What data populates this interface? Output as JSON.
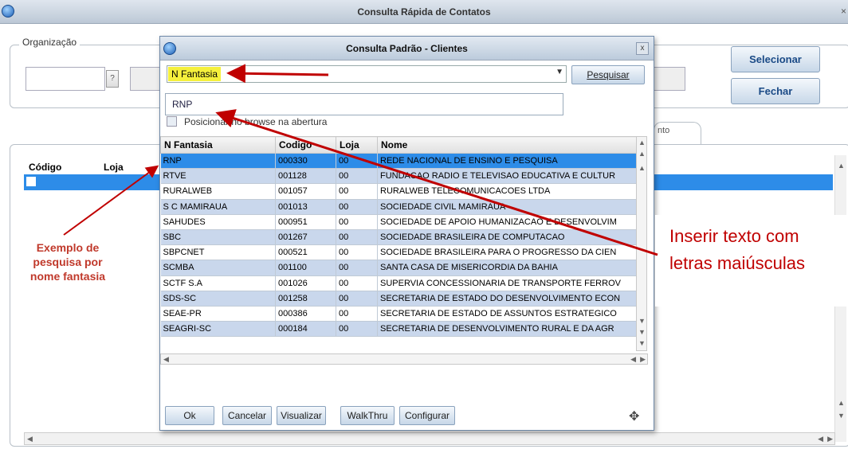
{
  "main_window": {
    "title": "Consulta Rápida de Contatos",
    "close_label": "×",
    "organization_label": "Organização",
    "help_button_label": "?",
    "select_button": "Selecionar",
    "close_button": "Fechar",
    "tab_fragment": "nto",
    "grid_columns": [
      "Código",
      "Loja"
    ]
  },
  "dialog": {
    "title": "Consulta Padrão - Clientes",
    "close_label": "x",
    "search_field_selected": "N Fantasia",
    "search_button": "Pesquisar",
    "search_value": "RNP",
    "position_checkbox_label": "Posicionar no browse na abertura",
    "columns": [
      "N Fantasia",
      "Codigo",
      "Loja",
      "Nome"
    ],
    "rows": [
      [
        "RNP",
        "000330",
        "00",
        "REDE NACIONAL DE ENSINO E PESQUISA"
      ],
      [
        "RTVE",
        "001128",
        "00",
        "FUNDACAO RADIO E TELEVISAO EDUCATIVA E CULTUR"
      ],
      [
        "RURALWEB",
        "001057",
        "00",
        "RURALWEB TELECOMUNICACOES LTDA"
      ],
      [
        "S C MAMIRAUA",
        "001013",
        "00",
        "SOCIEDADE CIVIL MAMIRAUA"
      ],
      [
        "SAHUDES",
        "000951",
        "00",
        "SOCIEDADE DE APOIO HUMANIZACAO E DESENVOLVIM"
      ],
      [
        "SBC",
        "001267",
        "00",
        "SOCIEDADE BRASILEIRA DE COMPUTACAO"
      ],
      [
        "SBPCNET",
        "000521",
        "00",
        "SOCIEDADE BRASILEIRA PARA O PROGRESSO DA CIEN"
      ],
      [
        "SCMBA",
        "001100",
        "00",
        "SANTA CASA DE MISERICORDIA DA BAHIA"
      ],
      [
        "SCTF S.A",
        "001026",
        "00",
        "SUPERVIA CONCESSIONARIA DE TRANSPORTE FERROV"
      ],
      [
        "SDS-SC",
        "001258",
        "00",
        "SECRETARIA DE ESTADO DO DESENVOLVIMENTO ECON"
      ],
      [
        "SEAE-PR",
        "000386",
        "00",
        "SECRETARIA DE ESTADO DE ASSUNTOS ESTRATEGICO"
      ],
      [
        "SEAGRI-SC",
        "000184",
        "00",
        "SECRETARIA DE DESENVOLVIMENTO RURAL E DA AGR"
      ]
    ],
    "buttons": [
      "Ok",
      "Cancelar",
      "Visualizar",
      "WalkThru",
      "Configurar"
    ]
  },
  "annotations": {
    "left": "Exemplo de pesquisa por nome fantasia",
    "right_line1": "Inserir texto com",
    "right_line2": "letras maiúsculas"
  },
  "colors": {
    "selected_row": "#2d8ce8",
    "alt_row": "#c9d7ec",
    "highlight": "#f5f03c",
    "annotation_red": "#c00000"
  }
}
